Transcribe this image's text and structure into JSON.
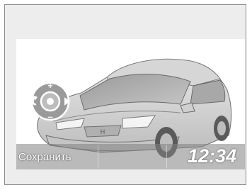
{
  "screen": {
    "save_label": "Сохранить",
    "clock": "12:34",
    "background_color": "#ffffff",
    "bar_color": "#828282"
  },
  "icons": {
    "dial": "selector-dial-icon",
    "car": "car-illustration"
  }
}
